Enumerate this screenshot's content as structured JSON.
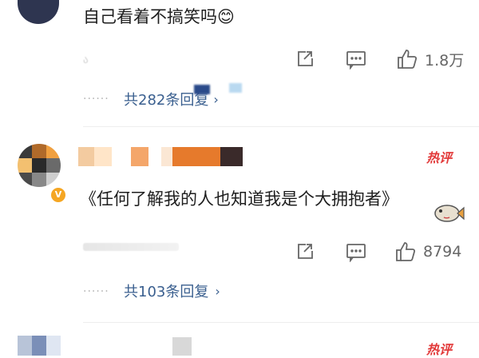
{
  "comments": [
    {
      "text": "自己看着不搞笑吗😊",
      "meta_fragment": "ა",
      "share_icon": "share-icon",
      "comment_icon": "comment-icon",
      "like_icon": "thumbs-up-icon",
      "like_count": "1.8万",
      "replies_label": "共282条回复"
    },
    {
      "badge": "热评",
      "text": "《任何了解我的人也知道我是个大拥抱者》",
      "verified_badge": "V",
      "like_count": "8794",
      "replies_label": "共103条回复"
    },
    {
      "badge": "热评"
    }
  ],
  "colors": {
    "link": "#3a5f8f",
    "hot_badge": "#e23a3a",
    "verified": "#f5a623",
    "icon": "#666666"
  }
}
